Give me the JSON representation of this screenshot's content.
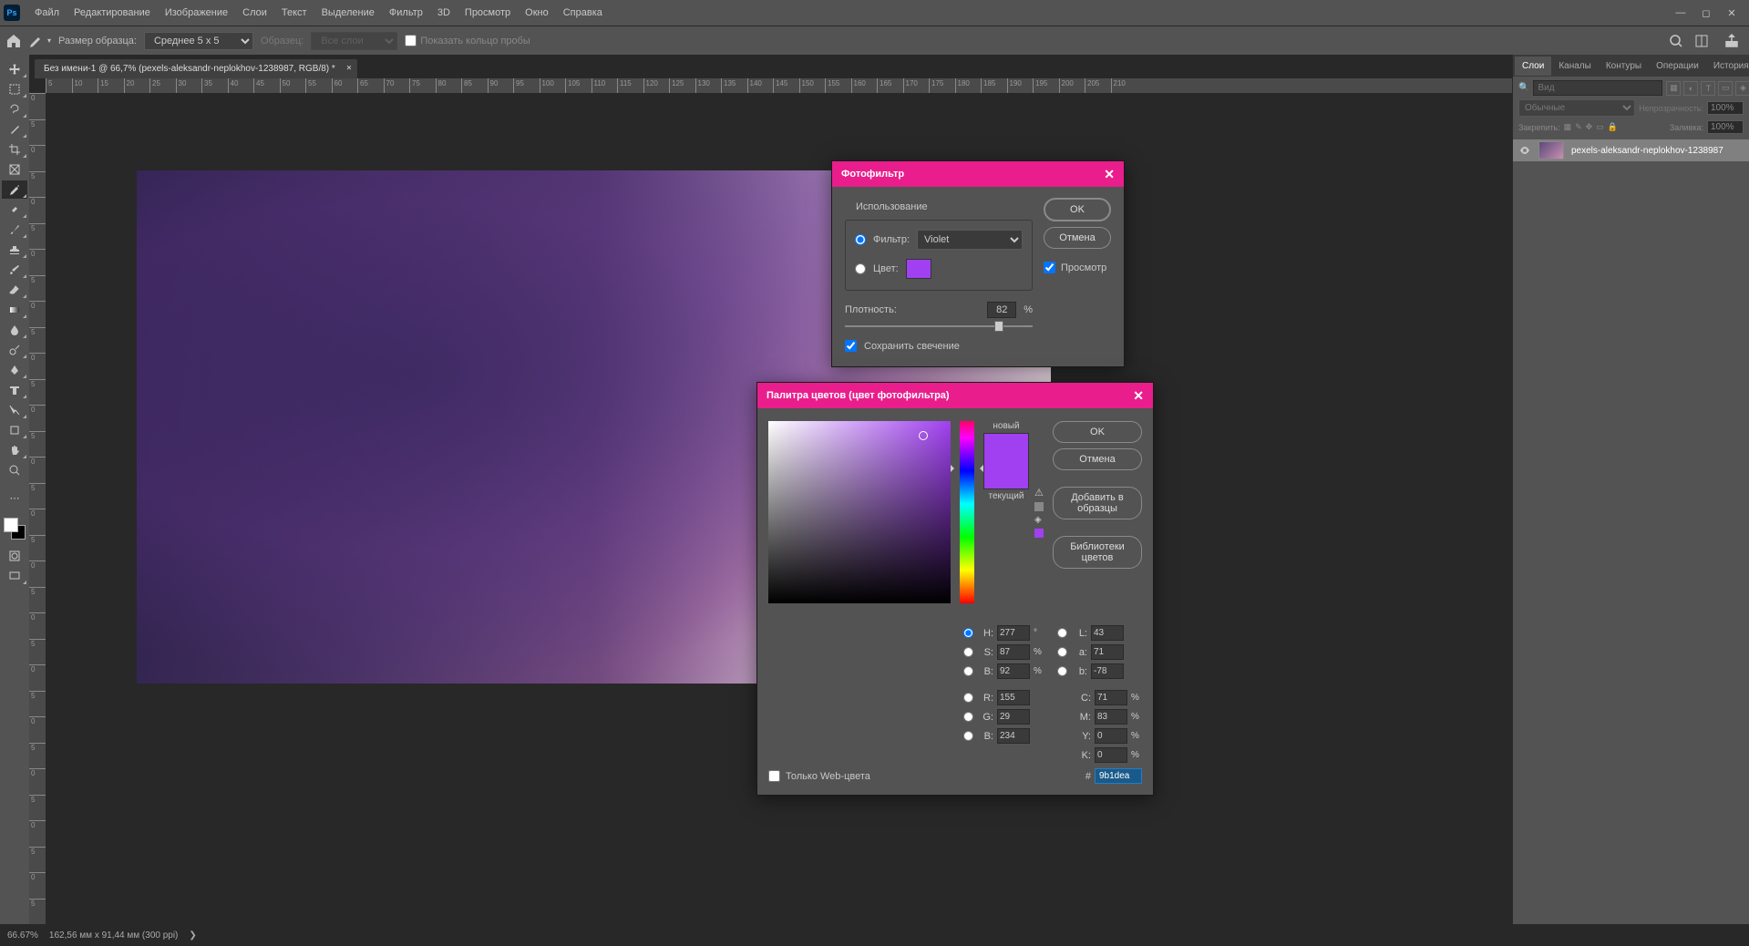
{
  "menu": {
    "items": [
      "Файл",
      "Редактирование",
      "Изображение",
      "Слои",
      "Текст",
      "Выделение",
      "Фильтр",
      "3D",
      "Просмотр",
      "Окно",
      "Справка"
    ]
  },
  "options_bar": {
    "sample_size_label": "Размер образца:",
    "sample_size_value": "Среднее 5 x 5",
    "sample_label": "Образец:",
    "sample_value": "Все слои",
    "show_ring": "Показать кольцо пробы"
  },
  "document": {
    "tab_title": "Без имени-1 @ 66,7% (pexels-aleksandr-neplokhov-1238987, RGB/8) *"
  },
  "ruler_h": [
    "5",
    "10",
    "15",
    "20",
    "25",
    "30",
    "35",
    "40",
    "45",
    "50",
    "55",
    "60",
    "65",
    "70",
    "75",
    "80",
    "85",
    "90",
    "95",
    "100",
    "105",
    "110",
    "115",
    "120",
    "125",
    "130",
    "135",
    "140",
    "145",
    "150",
    "155",
    "160",
    "165",
    "170",
    "175",
    "180",
    "185",
    "190",
    "195",
    "200",
    "205",
    "210"
  ],
  "ruler_v": [
    "0",
    "5",
    "0",
    "5",
    "0",
    "5",
    "0",
    "5",
    "0",
    "5",
    "0",
    "5",
    "0",
    "5",
    "0",
    "5",
    "0",
    "5",
    "0",
    "5",
    "0",
    "5",
    "0",
    "5",
    "0",
    "5",
    "0",
    "5",
    "0",
    "5",
    "0",
    "5"
  ],
  "right_panel": {
    "tabs": [
      "Слои",
      "Каналы",
      "Контуры",
      "Операции",
      "История"
    ],
    "search_placeholder": "Вид",
    "blend_mode": "Обычные",
    "opacity_label": "Непрозрачность:",
    "opacity_value": "100%",
    "lock_label": "Закрепить:",
    "fill_label": "Заливка:",
    "fill_value": "100%",
    "layer_name": "pexels-aleksandr-neplokhov-1238987"
  },
  "photo_filter": {
    "title": "Фотофильтр",
    "use_label": "Использование",
    "filter_label": "Фильтр:",
    "filter_value": "Violet",
    "color_label": "Цвет:",
    "density_label": "Плотность:",
    "density_value": "82",
    "density_unit": "%",
    "luminosity_label": "Сохранить свечение",
    "ok": "OK",
    "cancel": "Отмена",
    "preview": "Просмотр"
  },
  "color_picker": {
    "title": "Палитра цветов (цвет фотофильтра)",
    "ok": "OK",
    "cancel": "Отмена",
    "add_swatch": "Добавить в образцы",
    "libraries": "Библиотеки цветов",
    "new_label": "новый",
    "current_label": "текущий",
    "web_only": "Только Web-цвета",
    "hex_label": "#",
    "hex_value": "9b1dea",
    "values": {
      "H": "277",
      "H_unit": "°",
      "S": "87",
      "S_unit": "%",
      "B": "92",
      "B_unit": "%",
      "L": "43",
      "a": "71",
      "b": "-78",
      "R": "155",
      "G": "29",
      "B2": "234",
      "C": "71",
      "C_unit": "%",
      "M": "83",
      "M_unit": "%",
      "Y": "0",
      "Y_unit": "%",
      "K": "0",
      "K_unit": "%"
    }
  },
  "status": {
    "zoom": "66.67%",
    "dims": "162,56 мм x 91,44 мм (300 ppi)"
  }
}
